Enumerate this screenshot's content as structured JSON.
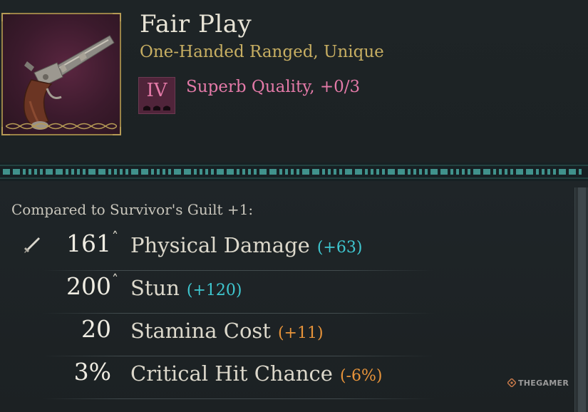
{
  "item": {
    "name": "Fair Play",
    "type": "One-Handed Ranged, Unique",
    "quality_numeral": "IV",
    "quality_text": "Superb Quality, +0/3",
    "quality_color": "#e47aa8",
    "image_icon": "flintlock-pistol-icon"
  },
  "comparison": {
    "label": "Compared to Survivor's Guilt +1:",
    "stats": [
      {
        "icon": "sword-icon",
        "value": "161",
        "arrow": "˄",
        "name": "Physical Damage",
        "diff": "(+63)",
        "diff_kind": "positive"
      },
      {
        "icon": "",
        "value": "200",
        "arrow": "˄",
        "name": "Stun",
        "diff": "(+120)",
        "diff_kind": "positive"
      },
      {
        "icon": "",
        "value": "20",
        "arrow": "",
        "name": "Stamina Cost",
        "diff": "(+11)",
        "diff_kind": "negative"
      },
      {
        "icon": "",
        "value": "3%",
        "arrow": "",
        "name": "Critical Hit Chance",
        "diff": "(-6%)",
        "diff_kind": "negative"
      }
    ]
  },
  "colors": {
    "positive": "#3fc7d0",
    "negative": "#e8943a",
    "item_type": "#c7ae62",
    "divider": "#4fb8b0"
  },
  "watermark": "THEGAMER"
}
